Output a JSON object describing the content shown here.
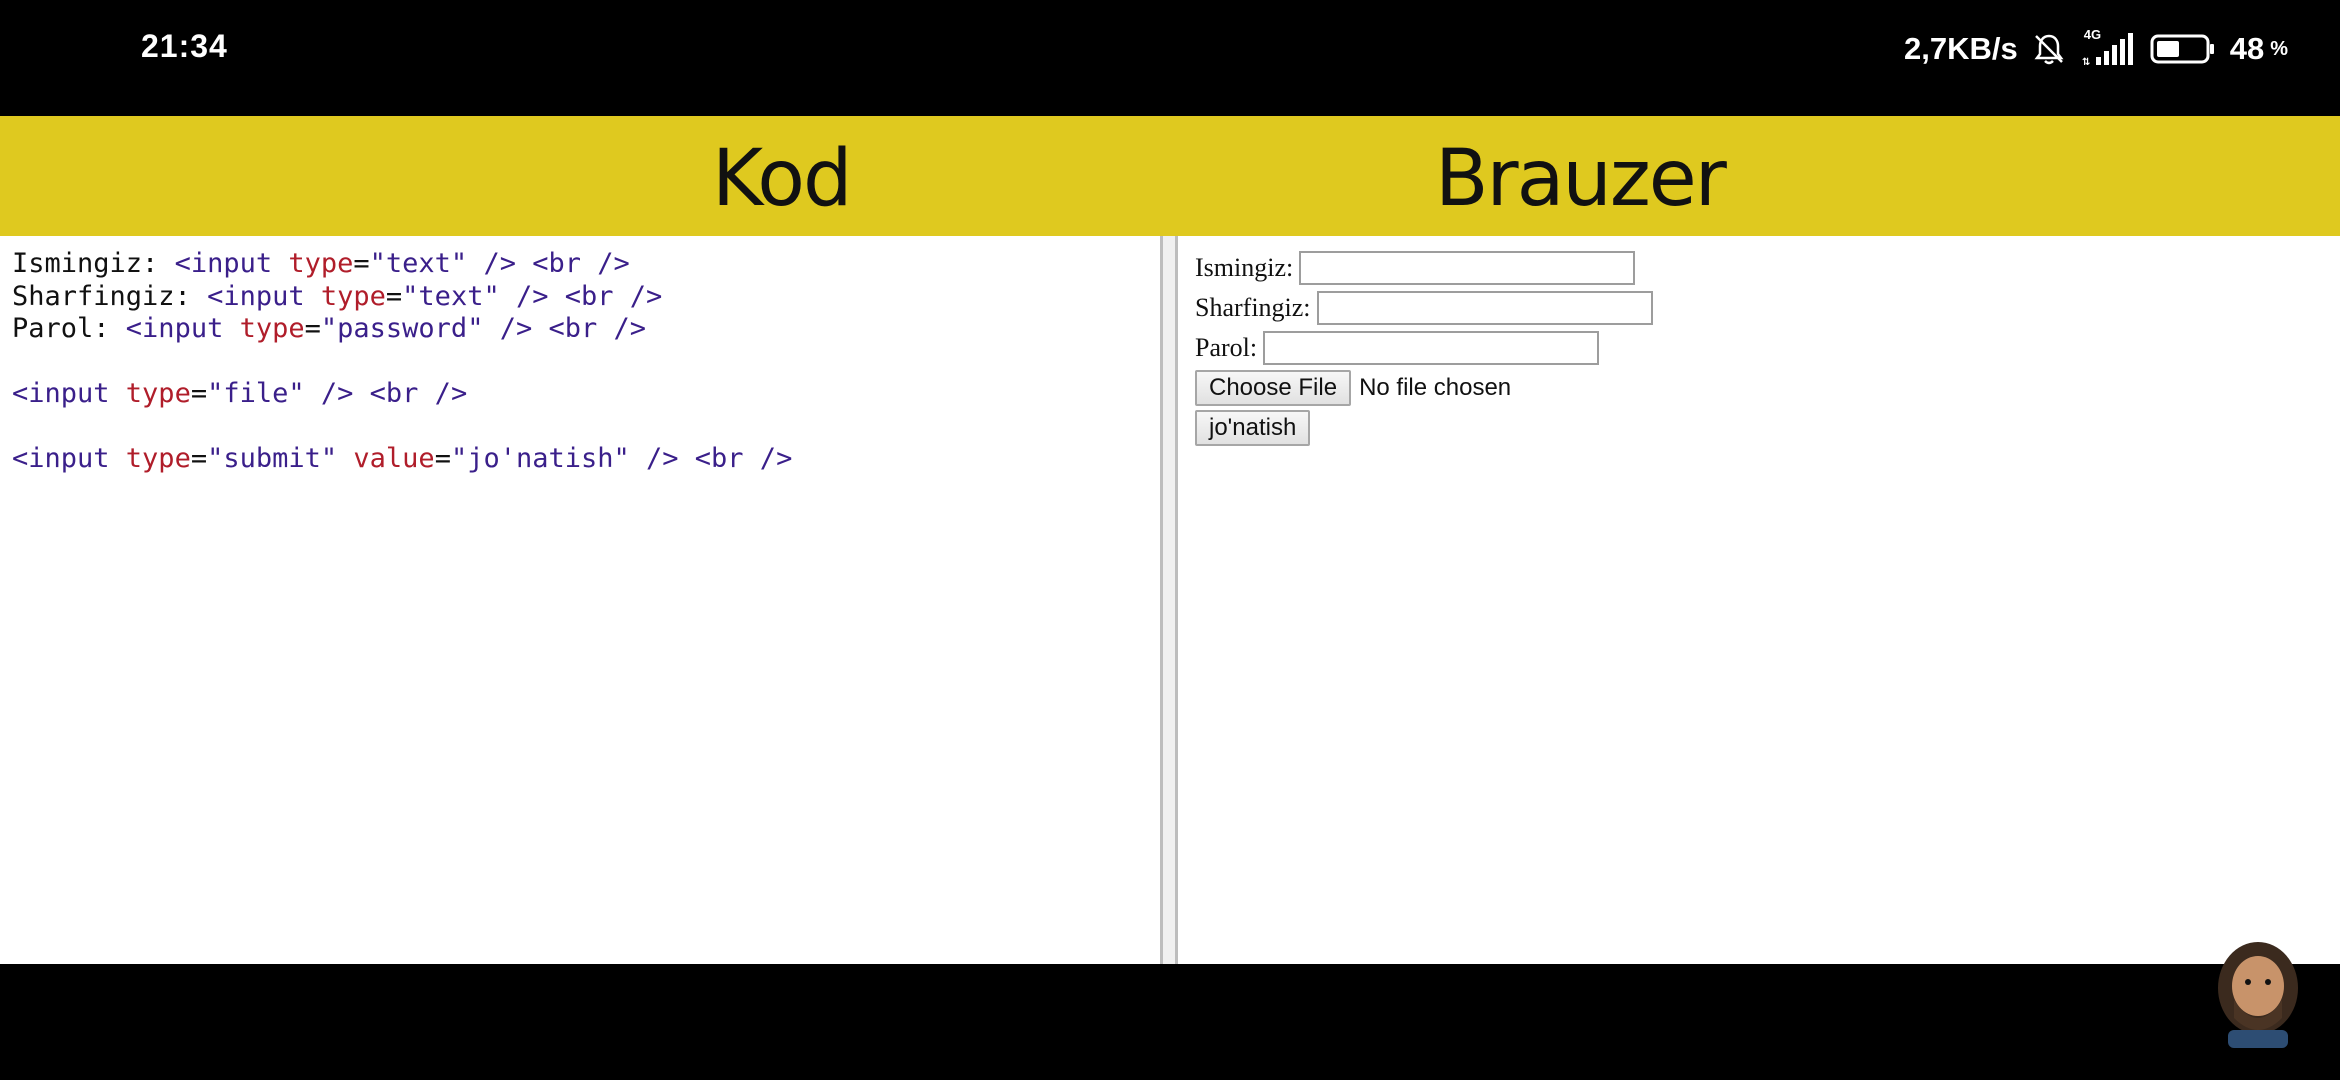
{
  "status_bar": {
    "time": "21:34",
    "network_speed": "2,7KB/s",
    "network_type": "4G",
    "battery_percent": "48",
    "battery_sign": "%",
    "icons": [
      "mute-bell-icon",
      "signal-icon",
      "battery-icon"
    ]
  },
  "banner": {
    "left_title": "Kod",
    "right_title": "Brauzer",
    "color": "#dfc91f"
  },
  "code_lines": [
    [
      {
        "t": "plain",
        "v": "Ismingiz: "
      },
      {
        "t": "tag",
        "v": "<input "
      },
      {
        "t": "attr",
        "v": "type"
      },
      {
        "t": "plain",
        "v": "="
      },
      {
        "t": "str",
        "v": "\"text\""
      },
      {
        "t": "tag",
        "v": " /> <br />"
      }
    ],
    [
      {
        "t": "plain",
        "v": "Sharfingiz: "
      },
      {
        "t": "tag",
        "v": "<input "
      },
      {
        "t": "attr",
        "v": "type"
      },
      {
        "t": "plain",
        "v": "="
      },
      {
        "t": "str",
        "v": "\"text\""
      },
      {
        "t": "tag",
        "v": " /> <br />"
      }
    ],
    [
      {
        "t": "plain",
        "v": "Parol: "
      },
      {
        "t": "tag",
        "v": "<input "
      },
      {
        "t": "attr",
        "v": "type"
      },
      {
        "t": "plain",
        "v": "="
      },
      {
        "t": "str",
        "v": "\"password\""
      },
      {
        "t": "tag",
        "v": " /> <br />"
      }
    ],
    [],
    [
      {
        "t": "tag",
        "v": "<input "
      },
      {
        "t": "attr",
        "v": "type"
      },
      {
        "t": "plain",
        "v": "="
      },
      {
        "t": "str",
        "v": "\"file\""
      },
      {
        "t": "tag",
        "v": " /> <br />"
      }
    ],
    [],
    [
      {
        "t": "tag",
        "v": "<input "
      },
      {
        "t": "attr",
        "v": "type"
      },
      {
        "t": "plain",
        "v": "="
      },
      {
        "t": "str",
        "v": "\"submit\" "
      },
      {
        "t": "attr",
        "v": "value"
      },
      {
        "t": "plain",
        "v": "="
      },
      {
        "t": "str",
        "v": "\"jo'natish\""
      },
      {
        "t": "tag",
        "v": " /> <br />"
      }
    ]
  ],
  "browser_form": {
    "name_label": "Ismingiz:",
    "surname_label": "Sharfingiz:",
    "password_label": "Parol:",
    "name_value": "",
    "surname_value": "",
    "password_value": "",
    "file_button": "Choose File",
    "file_status": "No file chosen",
    "submit_label": "jo'natish"
  }
}
